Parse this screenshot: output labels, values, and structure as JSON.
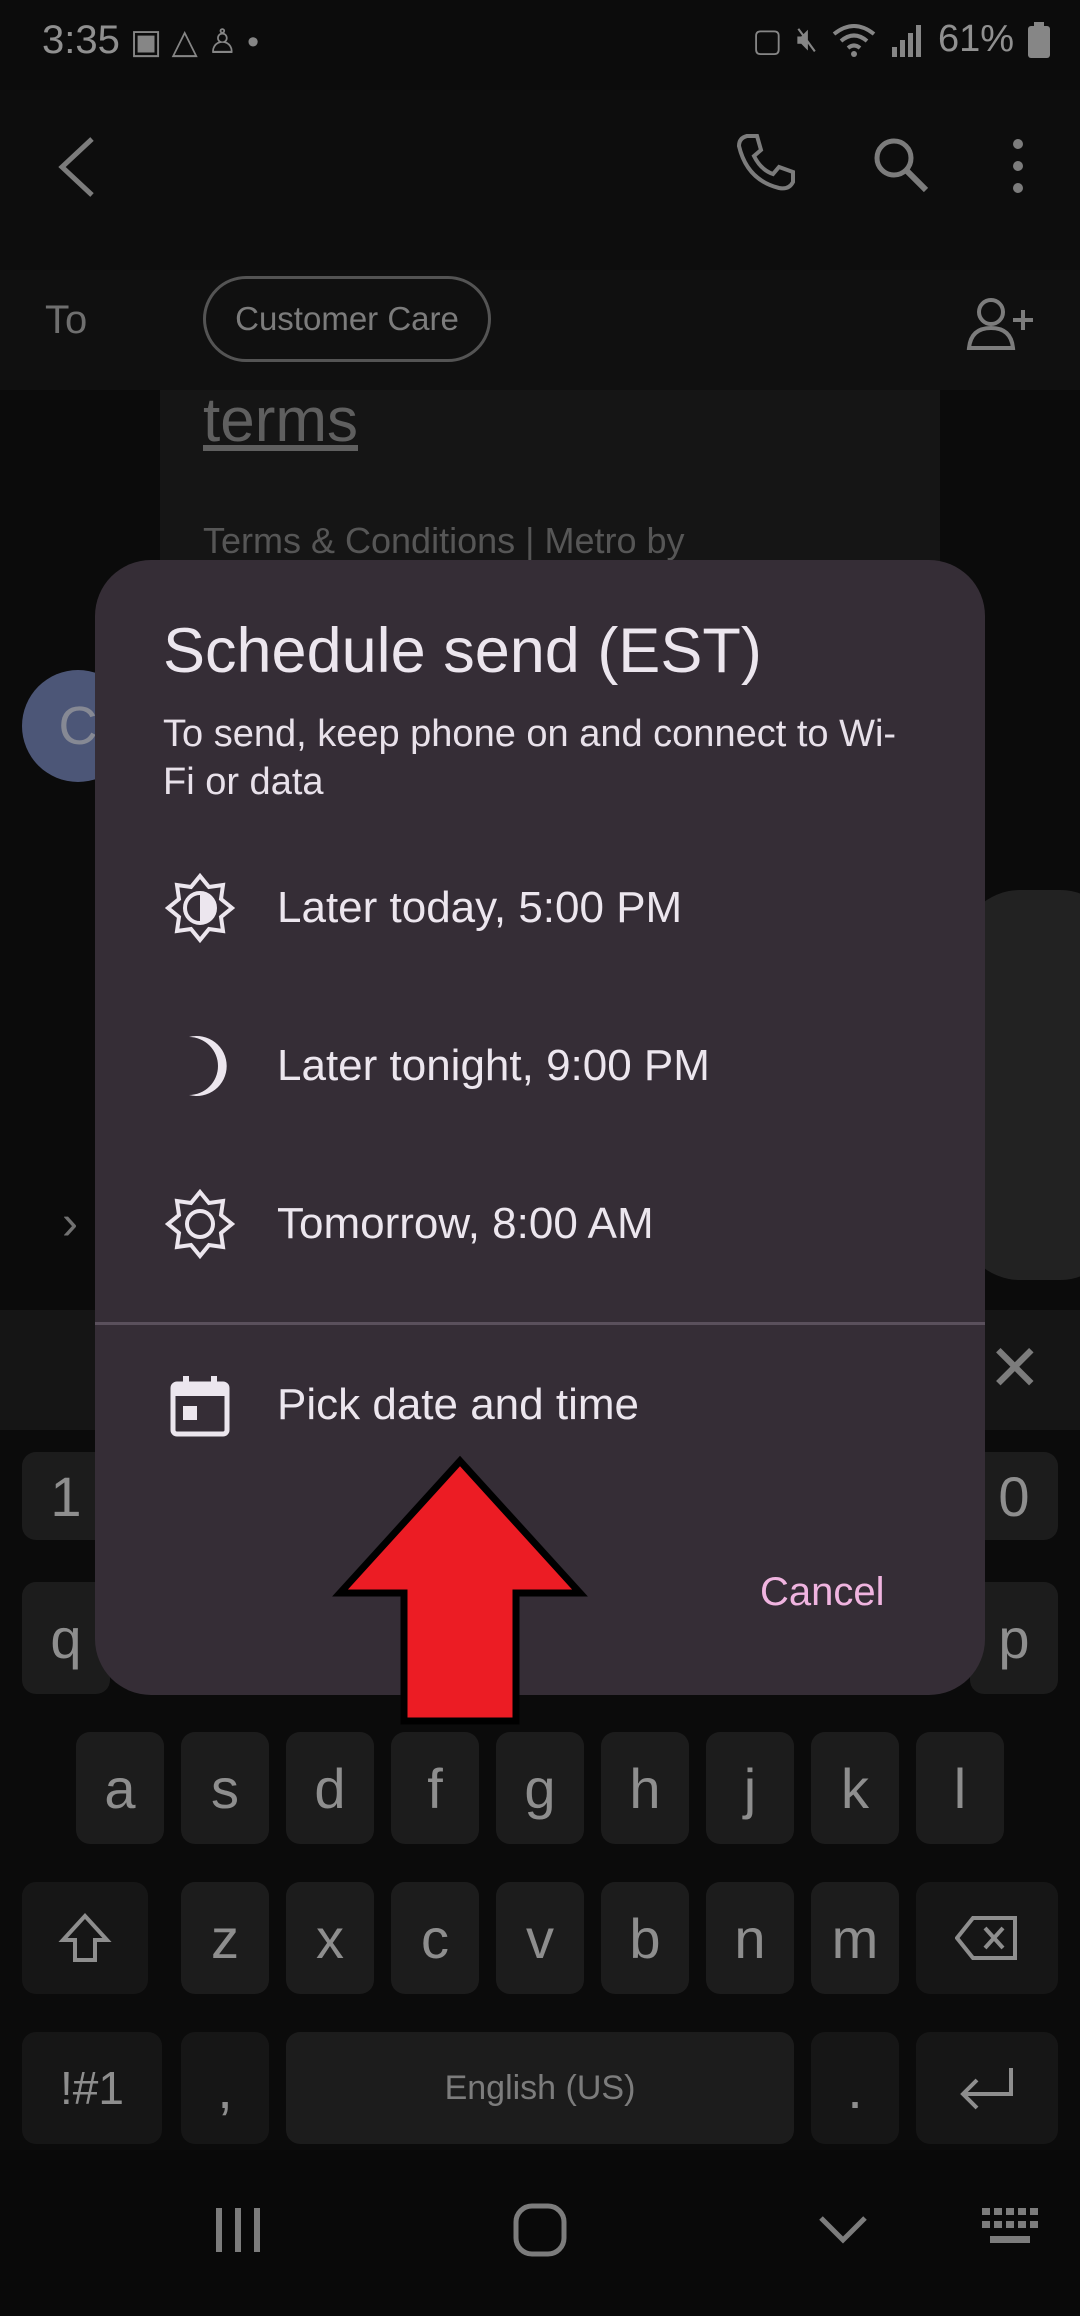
{
  "status_bar": {
    "time": "3:35",
    "battery_percent": "61%"
  },
  "conversation": {
    "to_label": "To",
    "recipient": "Customer Care",
    "link_card_title": "terms",
    "link_card_body": "Terms & Conditions | Metro by",
    "avatar_initial": "C"
  },
  "dialog": {
    "title": "Schedule send (EST)",
    "subtitle": "To send, keep phone on and connect to Wi-Fi or data",
    "options": [
      {
        "label": "Later today, 5:00 PM",
        "icon": "sun-icon"
      },
      {
        "label": "Later tonight, 9:00 PM",
        "icon": "moon-icon"
      },
      {
        "label": "Tomorrow, 8:00 AM",
        "icon": "sunrise-icon"
      },
      {
        "label": "Pick date and time",
        "icon": "calendar-icon"
      }
    ],
    "cancel": "Cancel"
  },
  "keyboard": {
    "row_numbers_visible": [
      "1",
      "0"
    ],
    "row_q_visible": [
      "q",
      "p"
    ],
    "row_a": [
      "a",
      "s",
      "d",
      "f",
      "g",
      "h",
      "j",
      "k",
      "l"
    ],
    "row_z": [
      "z",
      "x",
      "c",
      "v",
      "b",
      "n",
      "m"
    ],
    "symbols_key": "!#1",
    "comma_key": ",",
    "space_key": "English (US)",
    "period_key": "."
  },
  "colors": {
    "dialog_bg": "#352d36",
    "accent": "#f0b4e0",
    "annotation_arrow": "#ec1c24"
  }
}
